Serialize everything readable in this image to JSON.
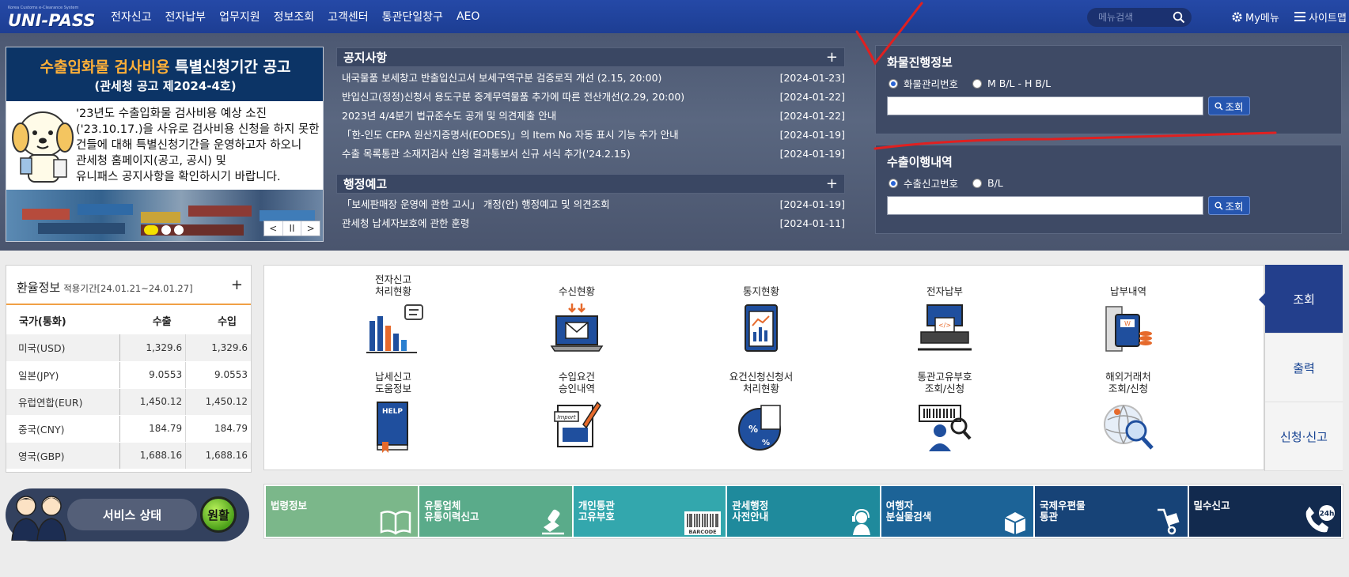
{
  "header": {
    "logo_small": "Korea Customs e-Clearance System",
    "logo_text": "UNI-PASS",
    "menu": [
      "전자신고",
      "전자납부",
      "업무지원",
      "정보조회",
      "고객센터",
      "통관단일창구",
      "AEO"
    ],
    "search_placeholder": "메뉴검색",
    "my_menu": "My메뉴",
    "sitemap": "사이트맵"
  },
  "banner": {
    "title_highlight": "수출입화물 검사비용",
    "title_rest": " 특별신청기간 공고",
    "subtitle": "(관세청 공고 제2024-4호)",
    "body_lines": [
      "'23년도 수출입화물 검사비용 예상 소진",
      "('23.10.17.)을 사유로 검사비용 신청을 하지 못한",
      "건들에 대해 특별신청기간을 운영하고자 하오니",
      "관세청 홈페이지(공고, 공시) 및",
      "유니패스 공지사항을 확인하시기 바랍니다."
    ],
    "prev": "<",
    "pause": "II",
    "next": ">"
  },
  "notices": {
    "title": "공지사항",
    "more": "+",
    "items": [
      {
        "title": "내국물품 보세창고 반출입신고서 보세구역구분 검증로직 개선 (2.15, 20:00)",
        "date": "[2024-01-23]"
      },
      {
        "title": "반입신고(정정)신청서 용도구분 중계무역물품 추가에 따른 전산개선(2.29, 20:00)",
        "date": "[2024-01-22]"
      },
      {
        "title": "2023년 4/4분기 법규준수도 공개 및 의견제출 안내",
        "date": "[2024-01-22]"
      },
      {
        "title": "「한-인도 CEPA 원산지증명서(EODES)」의 Item No 자동 표시 기능 추가 안내",
        "date": "[2024-01-19]"
      },
      {
        "title": "수출 목록통관 소재지검사 신청 결과통보서 신규 서식 추가('24.2.15)",
        "date": "[2024-01-19]"
      }
    ]
  },
  "admin_notices": {
    "title": "행정예고",
    "more": "+",
    "items": [
      {
        "title": "「보세판매장 운영에 관한 고시」 개정(안) 행정예고 및 의견조회",
        "date": "[2024-01-19]"
      },
      {
        "title": "관세청 납세자보호에 관한 훈령",
        "date": "[2024-01-11]"
      }
    ]
  },
  "cargo": {
    "title": "화물진행정보",
    "options": [
      "화물관리번호",
      "M B/L - H B/L"
    ],
    "button": "조회"
  },
  "export": {
    "title": "수출이행내역",
    "options": [
      "수출신고번호",
      "B/L"
    ],
    "button": "조회"
  },
  "exchange": {
    "title": "환율정보",
    "period": "적용기간[24.01.21~24.01.27]",
    "more": "+",
    "headers": [
      "국가(통화)",
      "수출",
      "수입"
    ],
    "rows": [
      [
        "미국(USD)",
        "1,329.6",
        "1,329.6"
      ],
      [
        "일본(JPY)",
        "9.0553",
        "9.0553"
      ],
      [
        "유럽연합(EUR)",
        "1,450.12",
        "1,450.12"
      ],
      [
        "중국(CNY)",
        "184.79",
        "184.79"
      ],
      [
        "영국(GBP)",
        "1,688.16",
        "1,688.16"
      ]
    ]
  },
  "services": [
    {
      "label": "전자신고\n처리현황",
      "icon": "bar-chart-icon"
    },
    {
      "label": "수신현황",
      "icon": "laptop-mail-icon"
    },
    {
      "label": "통지현황",
      "icon": "report-clipboard-icon"
    },
    {
      "label": "전자납부",
      "icon": "payment-terminal-icon"
    },
    {
      "label": "납부내역",
      "icon": "receipt-coins-icon"
    },
    {
      "label": "납세신고\n도움정보",
      "icon": "help-book-icon"
    },
    {
      "label": "수입요건\n승인내역",
      "icon": "import-document-icon"
    },
    {
      "label": "요건신청신청서\n처리현황",
      "icon": "percent-gear-icon"
    },
    {
      "label": "통관고유부호\n조회/신청",
      "icon": "barcode-person-icon"
    },
    {
      "label": "해외거래처\n조회/신청",
      "icon": "globe-search-icon"
    }
  ],
  "side_tabs": [
    "조회",
    "출력",
    "신청·신고"
  ],
  "service_status": {
    "label": "서비스 상태",
    "value": "원활"
  },
  "shortcuts": [
    {
      "label": "법령정보",
      "color": "#7bb78a",
      "icon": "book-icon"
    },
    {
      "label": "유통업체\n유통이력신고",
      "color": "#5aab8a",
      "icon": "stamp-icon"
    },
    {
      "label": "개인통관\n고유부호",
      "color": "#33a7ad",
      "icon": "barcode-icon",
      "icon_text": "BARCODE"
    },
    {
      "label": "관세행정\n사전안내",
      "color": "#1f8a9c",
      "icon": "operator-icon"
    },
    {
      "label": "여행자\n분실물검색",
      "color": "#1c6397",
      "icon": "box-icon"
    },
    {
      "label": "국제우편물\n통관",
      "color": "#174377",
      "icon": "hand-truck-icon"
    },
    {
      "label": "밀수신고",
      "color": "#122a4e",
      "icon": "phone-24h-icon",
      "icon_text": "24h"
    }
  ]
}
